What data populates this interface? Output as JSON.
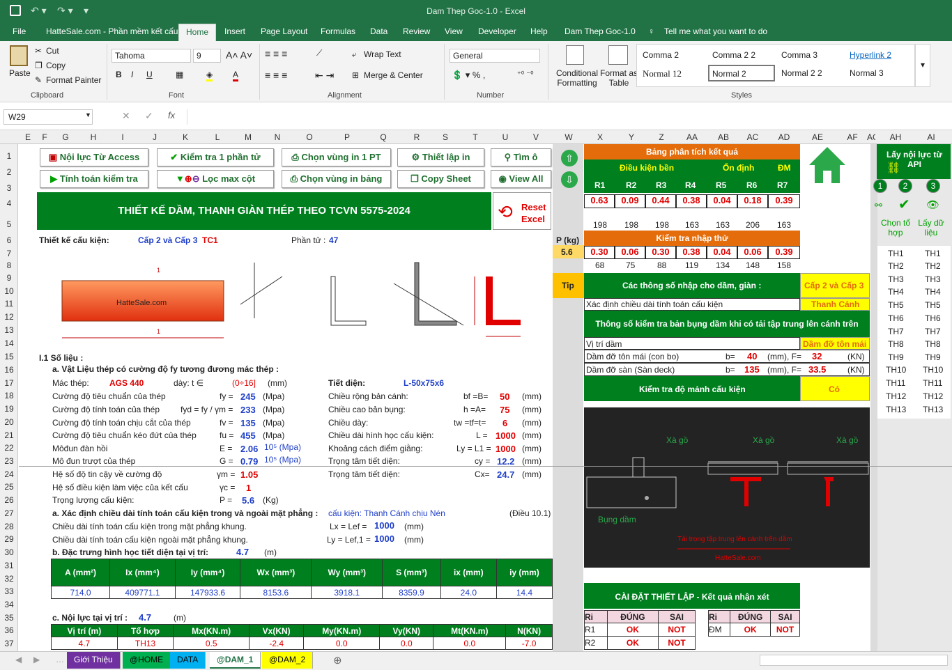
{
  "window": {
    "title": "Dam Thep Goc-1.0  -  Excel"
  },
  "tabs": [
    "File",
    "HatteSale.com - Phần mềm kết cấu",
    "Home",
    "Insert",
    "Page Layout",
    "Formulas",
    "Data",
    "Review",
    "View",
    "Developer",
    "Help",
    "Dam Thep Goc-1.0",
    "Tell me what you want to do"
  ],
  "ribbon": {
    "paste": "Paste",
    "cut": "Cut",
    "copy": "Copy",
    "format_painter": "Format Painter",
    "clipboard": "Clipboard",
    "font_name": "Tahoma",
    "font_size": "9",
    "font": "Font",
    "wrap_text": "Wrap Text",
    "merge_center": "Merge & Center",
    "alignment": "Alignment",
    "number_format": "General",
    "number": "Number",
    "cond_format": "Conditional Formatting",
    "format_table": "Format as Table",
    "styles": [
      "Comma 2",
      "Comma 2 2",
      "Comma 3",
      "Hyperlink 2",
      "Normal 12",
      "Normal 2",
      "Normal 2 2",
      "Normal 3"
    ],
    "styles_label": "Styles"
  },
  "formula_bar": {
    "name_box": "W29"
  },
  "columns": [
    "E",
    "F",
    "G",
    "H",
    "I",
    "J",
    "K",
    "L",
    "M",
    "N",
    "O",
    "P",
    "Q",
    "R",
    "S",
    "T",
    "U",
    "V",
    "W",
    "X",
    "Y",
    "Z",
    "AA",
    "AB",
    "AC",
    "AD",
    "AE",
    "AF",
    "AG",
    "AH",
    "AI"
  ],
  "rows": [
    "1",
    "2",
    "3",
    "4",
    "5",
    "6",
    "7",
    "8",
    "9",
    "10",
    "11",
    "12",
    "13",
    "14",
    "15",
    "16",
    "17",
    "18",
    "19",
    "20",
    "21",
    "22",
    "23",
    "24",
    "25",
    "26",
    "27",
    "28",
    "29",
    "30",
    "31",
    "32",
    "33",
    "34",
    "35",
    "36",
    "37"
  ],
  "buttons": {
    "access": "Nội lực Từ Access",
    "check1": "Kiểm tra 1 phần tử",
    "sel1": "Chọn vùng in 1 PT",
    "setup": "Thiết lập in",
    "find": "Tìm ô",
    "calc": "Tính toán kiểm tra",
    "filter": "Lọc max cột",
    "selt": "Chọn vùng in bảng",
    "copy": "Copy Sheet",
    "viewall": "View All",
    "reset": "Reset Excel",
    "api": "Lấy nội lực từ API"
  },
  "header": {
    "title": "THIẾT KẾ DẦM, THANH GIÀN THÉP THEO TCVN 5575-2024"
  },
  "design": {
    "label": "Thiết kế cấu kiện:",
    "grade": "Cấp 2 và Cấp 3",
    "tc": "TC1",
    "elem_label": "Phần tử :",
    "elem": "47"
  },
  "figure": {
    "site": "HatteSale.com"
  },
  "sec1": {
    "title": "I.1    Số liệu :",
    "mat_title": "a. Vật Liệu thép có cường độ fy tương đương mác thép :",
    "steel_label": "Mác thép:",
    "steel": "AGS 440",
    "thick_label": "dày: t ∈",
    "thick": "(0÷16]",
    "mm": "(mm)",
    "section_label": "Tiết diện:",
    "section": "L-50x75x6"
  },
  "props": [
    {
      "label": "Cường độ tiêu chuẩn của thép",
      "sym": "fy =",
      "val": "245",
      "unit": "(Mpa)"
    },
    {
      "label": "Cường độ tính toán của thép",
      "sym": "fyd = fy / γm =",
      "val": "233",
      "unit": "(Mpa)"
    },
    {
      "label": "Cường độ tính toán chịu cắt của thép",
      "sym": "fv =",
      "val": "135",
      "unit": "(Mpa)"
    },
    {
      "label": "Cường độ tiêu chuẩn kéo đứt của thép",
      "sym": "fu =",
      "val": "455",
      "unit": "(Mpa)"
    },
    {
      "label": "Môđun đàn hồi",
      "sym": "E =",
      "val": "2.06",
      "unit": "10⁵ (Mpa)"
    },
    {
      "label": "Mô đun trượt của thép",
      "sym": "G =",
      "val": "0.79",
      "unit": "10⁵ (Mpa)"
    },
    {
      "label": "Hệ số độ tin cậy về cường độ",
      "sym": "γm =",
      "val": "1.05",
      "unit": ""
    },
    {
      "label": "Hệ số điều kiện làm việc của kết cấu",
      "sym": "γc =",
      "val": "1",
      "unit": ""
    },
    {
      "label": "Trọng lượng cấu kiện:",
      "sym": "P =",
      "val": "5.6",
      "unit": "(Kg)"
    }
  ],
  "geom": [
    {
      "label": "Chiều rộng bản cánh:",
      "sym": "bf =B=",
      "val": "50",
      "unit": "(mm)"
    },
    {
      "label": "Chiều cao bản bụng:",
      "sym": "h =A=",
      "val": "75",
      "unit": "(mm)"
    },
    {
      "label": "Chiều dày:",
      "sym": "tw =tf=t=",
      "val": "6",
      "unit": "(mm)"
    },
    {
      "label": "Chiều dài hình học cấu kiện:",
      "sym": "L =",
      "val": "1000",
      "unit": "(mm)"
    },
    {
      "label": "Khoảng cách điểm giằng:",
      "sym": "Ly = L1 =",
      "val": "1000",
      "unit": "(mm)"
    },
    {
      "label": "Trọng tâm tiết diện:",
      "sym": "cy =",
      "val": "12.2",
      "unit": "(mm)"
    },
    {
      "label": "Trọng tâm tiết diện:",
      "sym": "Cx=",
      "val": "24.7",
      "unit": "(mm)"
    }
  ],
  "len": {
    "title": "a. Xác định chiều dài tính toán cấu kiện trong và ngoài mặt phẳng :",
    "member": "cấu kiện: Thanh Cánh chịu Nén",
    "clause": "(Điều 10.1)",
    "in_label": "Chiều dài tính toán cấu kiện trong mặt phẳng khung.",
    "in_sym": "Lx = Lef =",
    "in_val": "1000",
    "out_label": "Chiều dài tính toán cấu kiện ngoài mặt phẳng khung.",
    "out_sym": "Ly = Lef,1 =",
    "out_val": "1000",
    "unit": "(mm)"
  },
  "sect": {
    "title": "b. Đặc trưng hình học tiết diện tại vị trí:",
    "pos": "4.7",
    "unit": "(m)",
    "headers": [
      "A (mm²)",
      "Ix (mm⁴)",
      "Iy (mm⁴)",
      "Wx (mm³)",
      "Wy (mm³)",
      "S (mm³)",
      "ix (mm)",
      "iy (mm)"
    ],
    "values": [
      "714.0",
      "409771.1",
      "147933.6",
      "8153.6",
      "3918.1",
      "8359.9",
      "24.0",
      "14.4"
    ]
  },
  "force": {
    "title": "c. Nội lực tại vị trí :",
    "pos": "4.7",
    "unit": "(m)",
    "headers": [
      "Vị trí (m)",
      "Tổ hợp",
      "Mx(KN.m)",
      "Vx(KN)",
      "My(KN.m)",
      "Vy(KN)",
      "Mt(KN.m)",
      "N(KN)"
    ],
    "values": [
      "4.7",
      "TH13",
      "0.5",
      "-2.4",
      "0.0",
      "0.0",
      "0.0",
      "-7.0"
    ]
  },
  "results": {
    "title": "Bảng phân tích kết quả",
    "cond": "Điều kiện bền",
    "stab": "Ổn định",
    "dm": "ĐM",
    "R": [
      "R1",
      "R2",
      "R3",
      "R4",
      "R5",
      "R6",
      "R7"
    ],
    "Rv": [
      "0.63",
      "0.09",
      "0.44",
      "0.38",
      "0.04",
      "0.18",
      "0.39"
    ],
    "row5": [
      "198",
      "198",
      "198",
      "163",
      "163",
      "206",
      "163"
    ],
    "P_label": "P (kg)",
    "P": "5.6",
    "check_title": "Kiểm tra nhập thử",
    "check": [
      "0.30",
      "0.06",
      "0.30",
      "0.38",
      "0.04",
      "0.06",
      "0.39"
    ],
    "row8": [
      "68",
      "75",
      "88",
      "119",
      "134",
      "148",
      "158"
    ]
  },
  "params": {
    "tip": "Tip",
    "title": "Các thông số nhập cho dầm, giàn :",
    "grade": "Cấp 2 và Cấp 3",
    "len_label": "Xác định chiều dài tính toán cấu kiện",
    "len_val": "Thanh Cánh",
    "web_title": "Thông số kiểm tra bản bụng dầm khi có tải tập trung lên cánh trên",
    "pos_label": "Vị trí dầm",
    "pos_val": "Dầm đỡ tôn mái",
    "r1_label": "Dầm đỡ tôn mái    (con bo)",
    "r1_b": "b=",
    "r1_bv": "40",
    "r1_u": "(mm), F=",
    "r1_f": "32",
    "r1_fu": "(KN)",
    "r2_label": "Dầm đỡ sàn        (Sàn deck)",
    "r2_b": "b=",
    "r2_bv": "135",
    "r2_u": "(mm), F=",
    "r2_f": "33.5",
    "r2_fu": "(KN)",
    "slender": "Kiểm tra độ mảnh cấu kiện",
    "slender_val": "Có"
  },
  "cad": {
    "xa1": "Xà gồ",
    "xa2": "Xà gồ",
    "xa3": "Xà gồ",
    "bung": "Bụng dầm",
    "load": "Tải trọng tập trung lên cánh trên dầm",
    "site": "HatteSale.com"
  },
  "settings": {
    "title": "CÀI ĐẶT THIẾT LẬP - Kết quả nhận xét",
    "h1": [
      "Ri",
      "ĐÚNG",
      "SAI"
    ],
    "rows": [
      [
        "R1",
        "OK",
        "NOT"
      ],
      [
        "R2",
        "OK",
        "NOT"
      ]
    ],
    "h2": [
      "Ri",
      "ĐÚNG",
      "SAI"
    ],
    "rows2": [
      [
        "ĐM",
        "OK",
        "NOT"
      ]
    ]
  },
  "side": {
    "n1": "1",
    "n2": "2",
    "n3": "3",
    "c1": "Chọn tổ hợp",
    "c2": "Lấy dữ liệu",
    "th": [
      "TH1",
      "TH2",
      "TH3",
      "TH4",
      "TH5",
      "TH6",
      "TH7",
      "TH8",
      "TH9",
      "TH10",
      "TH11",
      "TH12",
      "TH13"
    ]
  },
  "sheets": [
    "Giới Thiệu",
    "@HOME",
    "DATA",
    "@DAM_1",
    "@DAM_2"
  ],
  "colors": {
    "excel_green": "#217346",
    "header_green": "#007f1f",
    "orange": "#e46c0a",
    "yellow": "#ffff00",
    "red": "#e00000"
  }
}
